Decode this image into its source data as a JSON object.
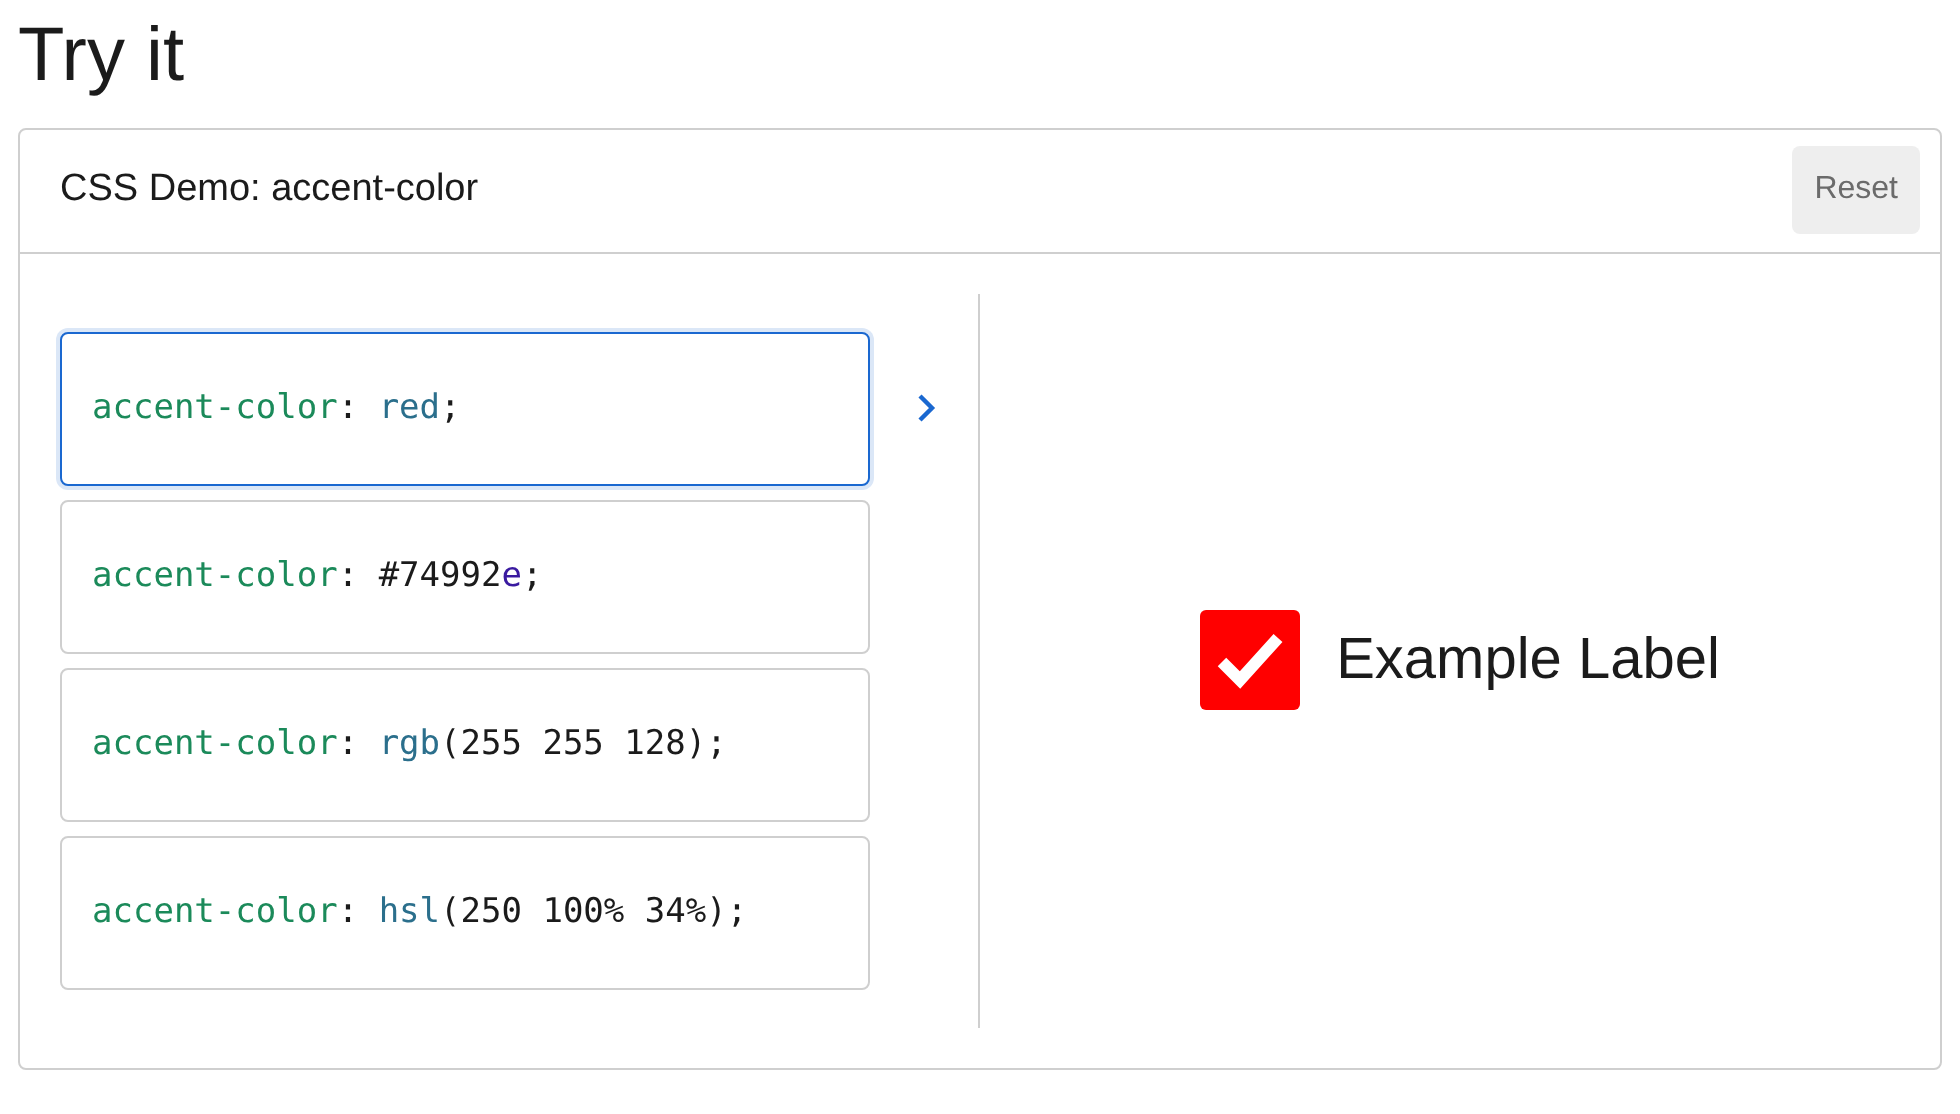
{
  "heading": "Try it",
  "demo": {
    "title": "CSS Demo: accent-color",
    "reset_button": "Reset",
    "choices": [
      {
        "selected": true,
        "tokens": [
          {
            "kind": "property",
            "text": "accent-color"
          },
          {
            "kind": "punct",
            "text": ": "
          },
          {
            "kind": "value",
            "text": "red"
          },
          {
            "kind": "punct",
            "text": ";"
          }
        ]
      },
      {
        "selected": false,
        "tokens": [
          {
            "kind": "property",
            "text": "accent-color"
          },
          {
            "kind": "punct",
            "text": ": "
          },
          {
            "kind": "plain",
            "text": "#74992"
          },
          {
            "kind": "hex",
            "text": "e"
          },
          {
            "kind": "punct",
            "text": ";"
          }
        ]
      },
      {
        "selected": false,
        "tokens": [
          {
            "kind": "property",
            "text": "accent-color"
          },
          {
            "kind": "punct",
            "text": ": "
          },
          {
            "kind": "value",
            "text": "rgb"
          },
          {
            "kind": "plain",
            "text": "(255 255 128);"
          }
        ]
      },
      {
        "selected": false,
        "tokens": [
          {
            "kind": "property",
            "text": "accent-color"
          },
          {
            "kind": "punct",
            "text": ": "
          },
          {
            "kind": "value",
            "text": "hsl"
          },
          {
            "kind": "plain",
            "text": "(250 100% 34%);"
          }
        ]
      }
    ],
    "output": {
      "checked": true,
      "label": "Example Label"
    }
  }
}
